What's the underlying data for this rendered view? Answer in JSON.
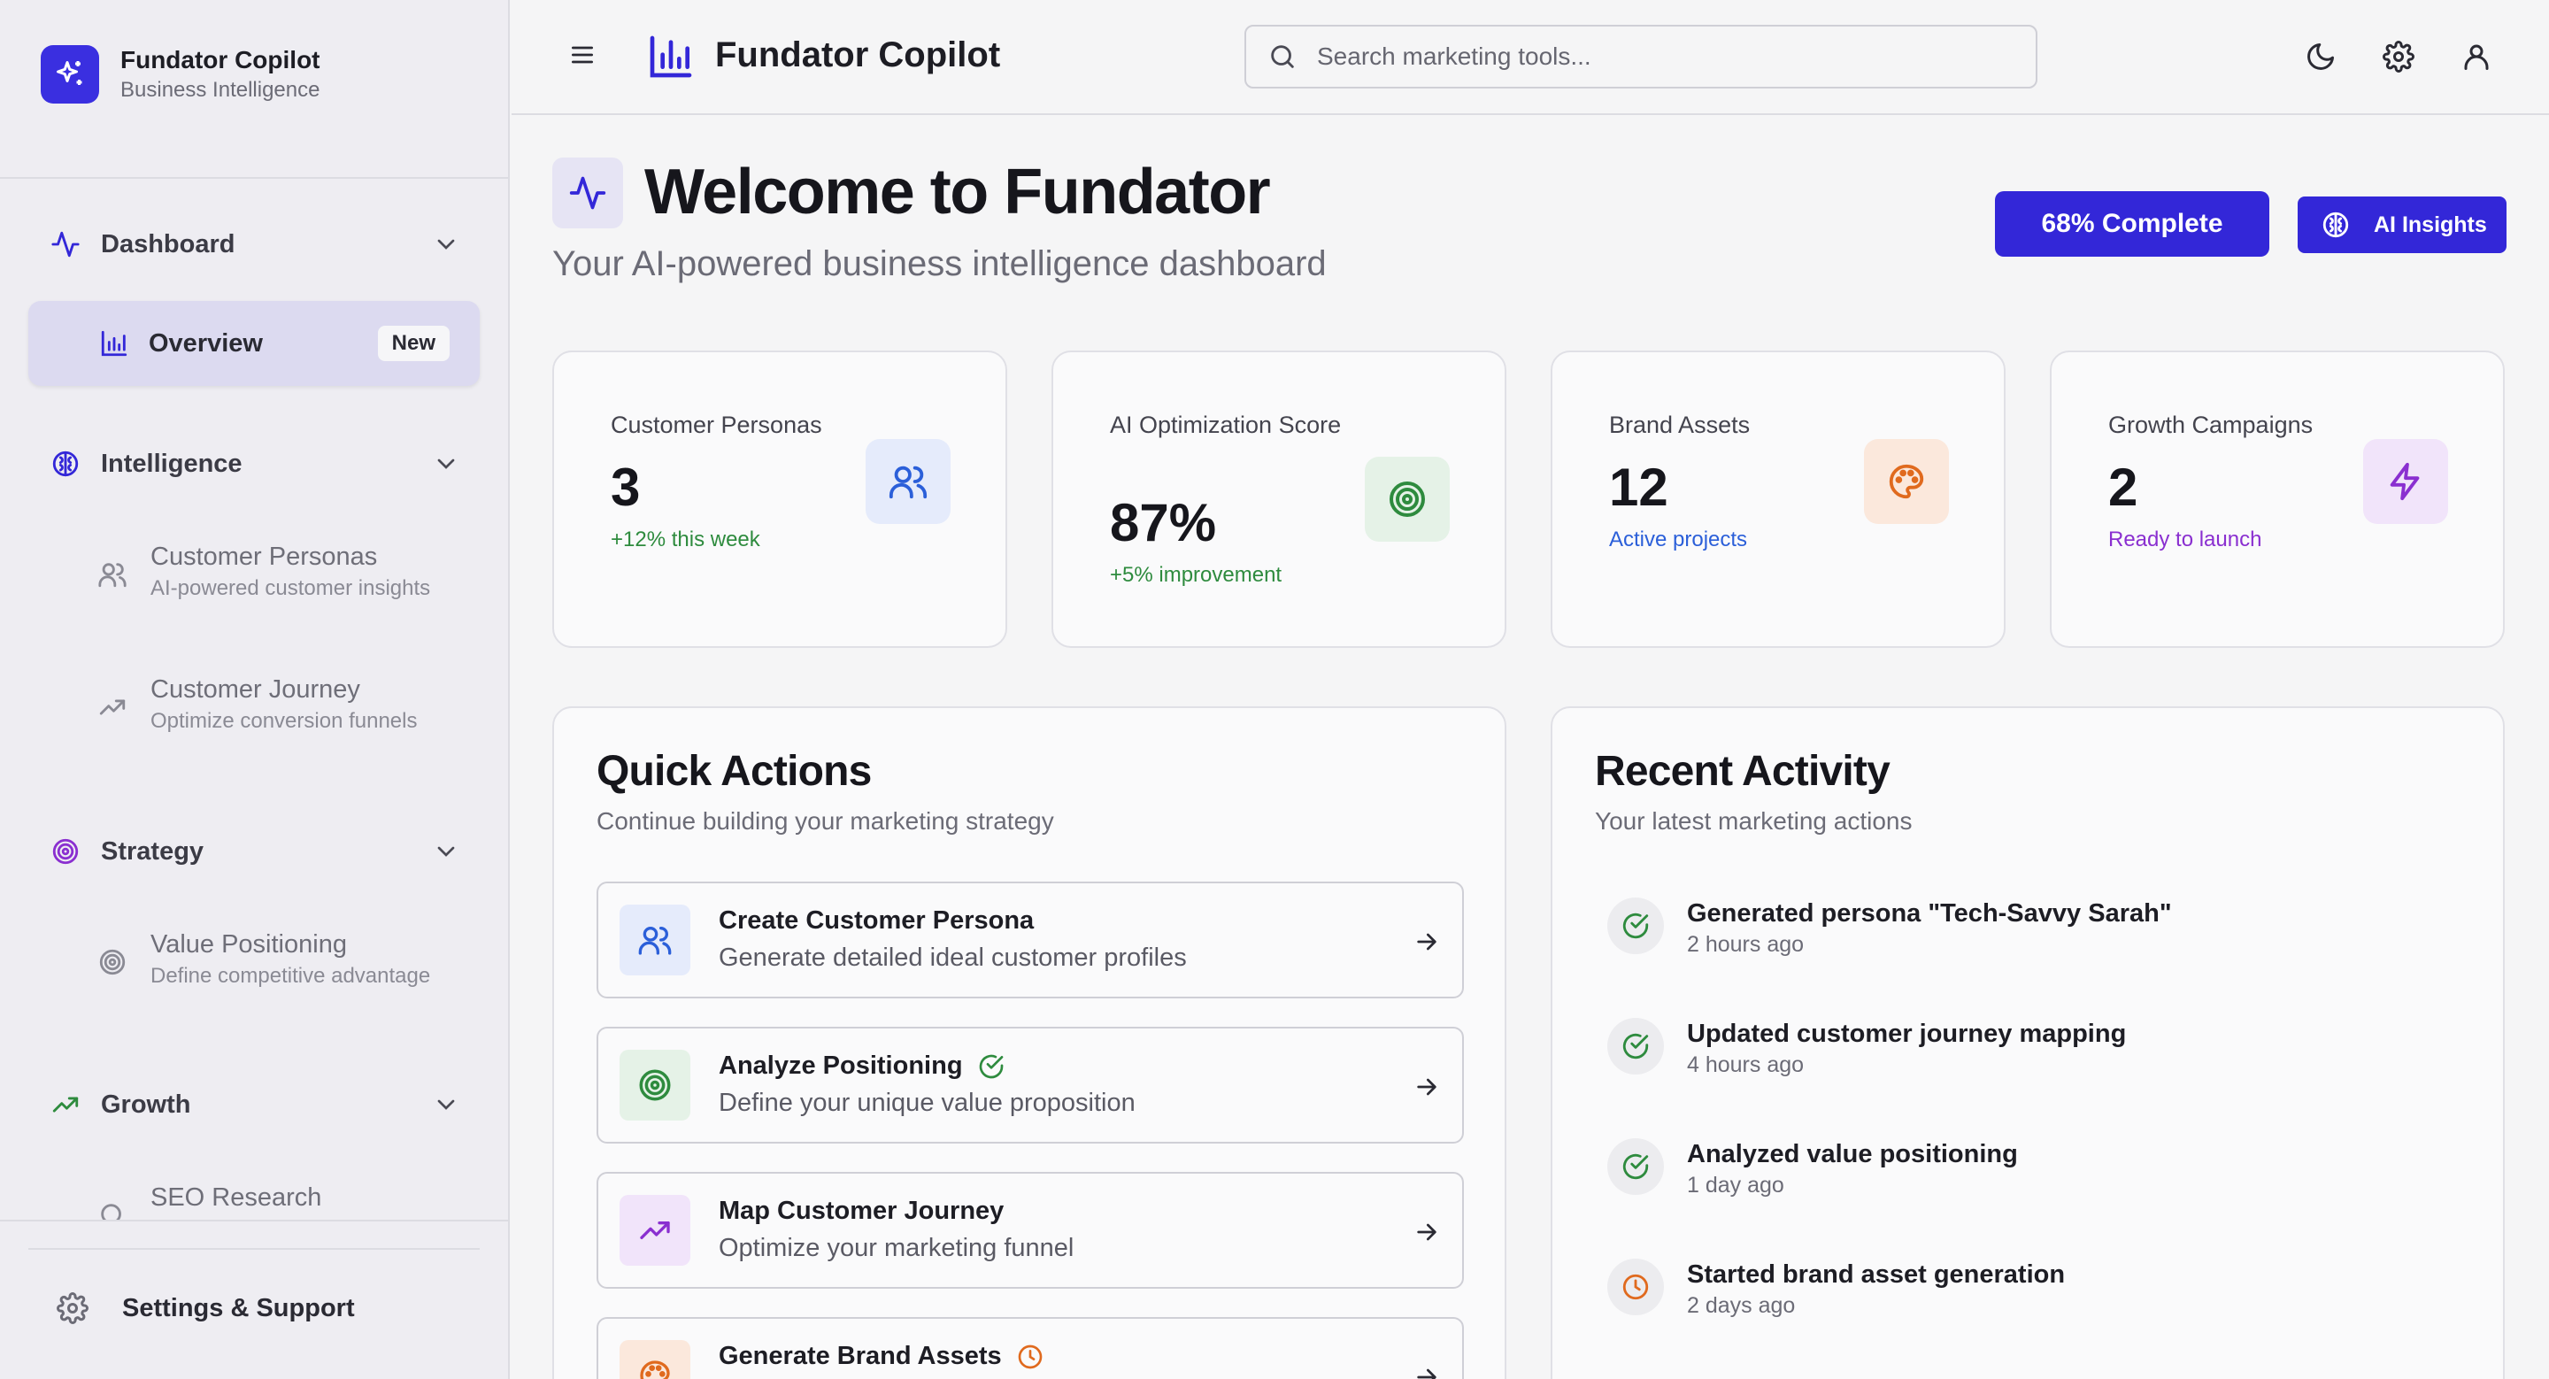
{
  "brand": {
    "title": "Fundator Copilot",
    "subtitle": "Business Intelligence"
  },
  "sidebar": {
    "groups": [
      {
        "label": "Dashboard",
        "icon": "activity-icon"
      },
      {
        "label": "Intelligence",
        "icon": "brain-icon"
      },
      {
        "label": "Strategy",
        "icon": "target-icon"
      },
      {
        "label": "Growth",
        "icon": "trending-up-icon"
      }
    ],
    "overview": {
      "label": "Overview",
      "badge": "New"
    },
    "sub_items": [
      {
        "title": "Customer Personas",
        "desc": "AI-powered customer insights",
        "icon": "users-icon"
      },
      {
        "title": "Customer Journey",
        "desc": "Optimize conversion funnels",
        "icon": "trending-up-icon"
      },
      {
        "title": "Value Positioning",
        "desc": "Define competitive advantage",
        "icon": "target-icon"
      },
      {
        "title": "SEO Research",
        "desc": "",
        "icon": "search-icon"
      }
    ],
    "settings_label": "Settings & Support"
  },
  "topbar": {
    "title": "Fundator Copilot",
    "search_placeholder": "Search marketing tools..."
  },
  "hero": {
    "title": "Welcome to Fundator",
    "subtitle": "Your AI-powered business intelligence dashboard",
    "progress_label": "68% Complete",
    "progress_value": 68,
    "insights_label": "AI Insights"
  },
  "stats": [
    {
      "label": "Customer Personas",
      "value": "3",
      "note": "+12% this week",
      "note_color": "#2e8b3e",
      "icon": "users-icon"
    },
    {
      "label": "AI Optimization Score",
      "value": "87%",
      "note": "+5% improvement",
      "note_color": "#2e8b3e",
      "icon": "target-icon"
    },
    {
      "label": "Brand Assets",
      "value": "12",
      "note": "Active projects",
      "note_color": "#2b5fd9",
      "icon": "palette-icon"
    },
    {
      "label": "Growth Campaigns",
      "value": "2",
      "note": "Ready to launch",
      "note_color": "#8a2fd0",
      "icon": "zap-icon"
    }
  ],
  "quick_actions": {
    "title": "Quick Actions",
    "subtitle": "Continue building your marketing strategy",
    "items": [
      {
        "title": "Create Customer Persona",
        "desc": "Generate detailed ideal customer profiles",
        "icon": "users-icon",
        "status": ""
      },
      {
        "title": "Analyze Positioning",
        "desc": "Define your unique value proposition",
        "icon": "target-icon",
        "status": "check-circle-icon"
      },
      {
        "title": "Map Customer Journey",
        "desc": "Optimize your marketing funnel",
        "icon": "trending-up-icon",
        "status": ""
      },
      {
        "title": "Generate Brand Assets",
        "desc": "",
        "icon": "palette-icon",
        "status": "clock-icon"
      }
    ]
  },
  "recent_activity": {
    "title": "Recent Activity",
    "subtitle": "Your latest marketing actions",
    "items": [
      {
        "title": "Generated persona \"Tech-Savvy Sarah\"",
        "time": "2 hours ago",
        "status": "check-circle-icon"
      },
      {
        "title": "Updated customer journey mapping",
        "time": "4 hours ago",
        "status": "check-circle-icon"
      },
      {
        "title": "Analyzed value positioning",
        "time": "1 day ago",
        "status": "check-circle-icon"
      },
      {
        "title": "Started brand asset generation",
        "time": "2 days ago",
        "status": "clock-icon"
      }
    ]
  },
  "colors": {
    "primary": "#3327d8",
    "success": "#2e8b3e",
    "info": "#2b5fd9",
    "purple": "#8a2fd0",
    "orange": "#e06a1e"
  }
}
